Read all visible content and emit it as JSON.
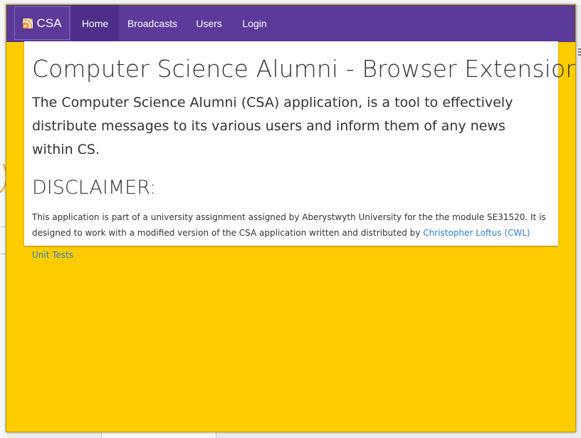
{
  "navbar": {
    "brand": {
      "label": "CSA",
      "icon": "rss-icon"
    },
    "items": [
      {
        "label": "Home",
        "active": true
      },
      {
        "label": "Broadcasts",
        "active": false
      },
      {
        "label": "Users",
        "active": false
      },
      {
        "label": "Login",
        "active": false
      }
    ]
  },
  "content": {
    "title": "Computer Science Alumni - Browser Extension",
    "lead": "The Computer Science Alumni (CSA) application, is a tool to effectively distribute messages to its various users and inform them of any news within CS.",
    "disclaimer_heading": "DISCLAIMER:",
    "disclaimer_text": "This application is part of a university assignment assigned by Aberystwyth University for the the module SE31520. It is designed to work with a modified version of the CSA application written and distributed by ",
    "author_link": "Christopher Loftus (CWL)",
    "unit_tests_link": "Unit Tests"
  },
  "colors": {
    "navbar": "#5b3a9a",
    "navbar_active": "#4d2f8a",
    "popup_background": "#ffcc00",
    "link": "#2b7ecb",
    "rss_icon": "#f79b33"
  }
}
